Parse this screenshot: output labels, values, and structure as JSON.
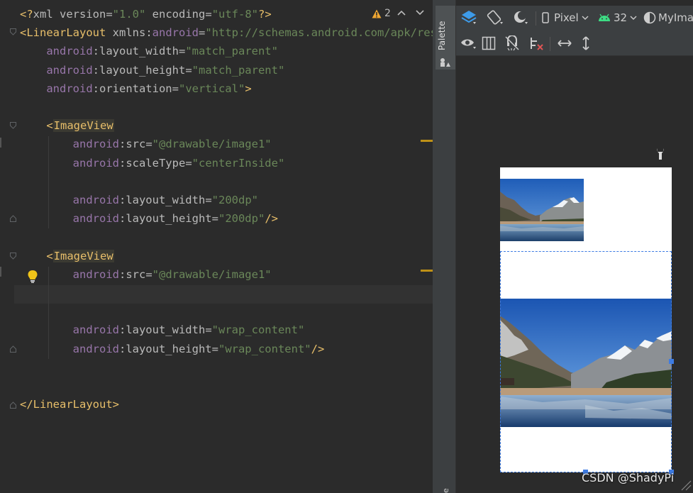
{
  "editor": {
    "lines": [
      [
        [
          "t-pi",
          "<?"
        ],
        [
          "t-attr",
          "xml version"
        ],
        [
          "t-attr",
          "="
        ],
        [
          "t-val",
          "\"1.0\""
        ],
        [
          "t-attr",
          " encoding"
        ],
        [
          "t-attr",
          "="
        ],
        [
          "t-val",
          "\"utf-8\""
        ],
        [
          "t-pi",
          "?>"
        ]
      ],
      [
        [
          "t-tag",
          "<"
        ],
        [
          "t-tagname",
          "LinearLayout"
        ],
        [
          "t-attr",
          " xmlns"
        ],
        [
          "t-attr",
          ":"
        ],
        [
          "t-ns",
          "android"
        ],
        [
          "t-attr",
          "="
        ],
        [
          "t-val",
          "\"http://schemas.android.com/apk/res/android\""
        ]
      ],
      [
        [
          "t-attr",
          "    "
        ],
        [
          "t-ns",
          "android"
        ],
        [
          "t-attr",
          ":layout_width"
        ],
        [
          "t-attr",
          "="
        ],
        [
          "t-val",
          "\"match_parent\""
        ]
      ],
      [
        [
          "t-attr",
          "    "
        ],
        [
          "t-ns",
          "android"
        ],
        [
          "t-attr",
          ":layout_height"
        ],
        [
          "t-attr",
          "="
        ],
        [
          "t-val",
          "\"match_parent\""
        ]
      ],
      [
        [
          "t-attr",
          "    "
        ],
        [
          "t-ns",
          "android"
        ],
        [
          "t-attr",
          ":orientation"
        ],
        [
          "t-attr",
          "="
        ],
        [
          "t-val",
          "\"vertical\""
        ],
        [
          "t-tag",
          ">"
        ]
      ],
      [],
      [
        [
          "t-attr",
          "    "
        ],
        [
          "t-tag",
          "<"
        ],
        [
          "t-tagname hl",
          "ImageView"
        ]
      ],
      [
        [
          "t-attr",
          "        "
        ],
        [
          "t-ns",
          "android"
        ],
        [
          "t-attr",
          ":src"
        ],
        [
          "t-attr",
          "="
        ],
        [
          "t-val",
          "\"@drawable/image1\""
        ]
      ],
      [
        [
          "t-attr",
          "        "
        ],
        [
          "t-ns",
          "android"
        ],
        [
          "t-attr",
          ":scaleType"
        ],
        [
          "t-attr",
          "="
        ],
        [
          "t-val",
          "\"centerInside\""
        ]
      ],
      [],
      [
        [
          "t-attr",
          "        "
        ],
        [
          "t-ns",
          "android"
        ],
        [
          "t-attr",
          ":layout_width"
        ],
        [
          "t-attr",
          "="
        ],
        [
          "t-val",
          "\"200dp\""
        ]
      ],
      [
        [
          "t-attr",
          "        "
        ],
        [
          "t-ns",
          "android"
        ],
        [
          "t-attr",
          ":layout_height"
        ],
        [
          "t-attr",
          "="
        ],
        [
          "t-val",
          "\"200dp\""
        ],
        [
          "t-tag",
          "/>"
        ]
      ],
      [],
      [
        [
          "t-attr",
          "    "
        ],
        [
          "t-tag",
          "<"
        ],
        [
          "t-tagname hl",
          "ImageView"
        ]
      ],
      [
        [
          "t-attr",
          "        "
        ],
        [
          "t-ns",
          "android"
        ],
        [
          "t-attr",
          ":src"
        ],
        [
          "t-attr",
          "="
        ],
        [
          "t-val",
          "\"@drawable/image1\""
        ]
      ],
      [],
      [],
      [
        [
          "t-attr",
          "        "
        ],
        [
          "t-ns",
          "android"
        ],
        [
          "t-attr",
          ":layout_width"
        ],
        [
          "t-attr",
          "="
        ],
        [
          "t-val",
          "\"wrap_content\""
        ]
      ],
      [
        [
          "t-attr",
          "        "
        ],
        [
          "t-ns",
          "android"
        ],
        [
          "t-attr",
          ":layout_height"
        ],
        [
          "t-attr",
          "="
        ],
        [
          "t-val",
          "\"wrap_content\""
        ],
        [
          "t-tag",
          "/>"
        ]
      ],
      [],
      [],
      [
        [
          "t-tag",
          "</"
        ],
        [
          "t-tagname",
          "LinearLayout"
        ],
        [
          "t-tag",
          ">"
        ]
      ]
    ],
    "warning_count": "2"
  },
  "palette": {
    "label": "Palette",
    "bottom_label": "e"
  },
  "design_toolbar": {
    "device": "Pixel",
    "api_level": "32",
    "theme": "MyIma"
  },
  "watermark": "CSDN @ShadyPi",
  "colors": {
    "accent": "#3d7be3",
    "warning": "#be9117",
    "android_green": "#3ddc84"
  }
}
